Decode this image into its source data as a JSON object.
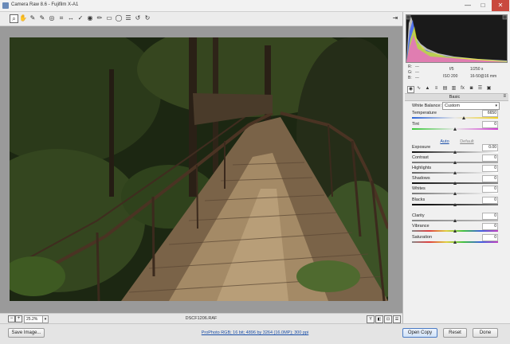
{
  "window": {
    "title": "Camera Raw 8.6  -  Fujifilm X-A1",
    "controls": {
      "minimize": "—",
      "maximize": "□",
      "close": "✕"
    }
  },
  "toolbar": {
    "tools": [
      "zoom-tool",
      "hand-tool",
      "white-balance-tool",
      "color-sampler-tool",
      "targeted-adjustment-tool",
      "crop-tool",
      "straighten-tool",
      "spot-removal-tool",
      "red-eye-tool",
      "adjustment-brush-tool",
      "graduated-filter-tool",
      "radial-filter-tool",
      "open-preferences",
      "rotate-ccw",
      "rotate-cw"
    ],
    "glyphs": [
      "⌕",
      "✋",
      "✎",
      "✎",
      "◎",
      "⌗",
      "↔",
      "✓",
      "◉",
      "✏",
      "▭",
      "◯",
      "☰",
      "↺",
      "↻"
    ],
    "fullscreen_glyph": "⇥"
  },
  "status": {
    "zoom_value": "25.2%",
    "zoom_out": "−",
    "zoom_in": "+",
    "dropdown": "▾",
    "filename": "DSCF1206.RAF",
    "right_icons": [
      "Y",
      "◧",
      "⊡",
      "☰"
    ]
  },
  "info": {
    "rgb": {
      "R": "R:",
      "G": "G:",
      "B": "B:",
      "r_val": "---",
      "g_val": "---",
      "b_val": "---"
    },
    "aperture": "f/5",
    "shutter": "1/250 s",
    "iso": "ISO 200",
    "lens": "16-50@16 mm"
  },
  "panel_tabs": [
    "◉",
    "∿",
    "▲",
    "≡",
    "▤",
    "▥",
    "fx",
    "◙",
    "☰",
    "▣"
  ],
  "basic": {
    "title": "Basic",
    "menu": "≡",
    "wb_label": "White Balance:",
    "wb_value": "Custom",
    "wb_arrow": "▾",
    "auto": "Auto",
    "default": "Default",
    "sliders": [
      {
        "name": "temperature",
        "label": "Temperature",
        "value": "6650",
        "pos": 0.6
      },
      {
        "name": "tint",
        "label": "Tint",
        "value": "0",
        "pos": 0.5
      },
      {
        "name": "exposure",
        "label": "Exposure",
        "value": "0.00",
        "pos": 0.5
      },
      {
        "name": "contrast",
        "label": "Contrast",
        "value": "0",
        "pos": 0.5
      },
      {
        "name": "highlights",
        "label": "Highlights",
        "value": "0",
        "pos": 0.5
      },
      {
        "name": "shadows",
        "label": "Shadows",
        "value": "0",
        "pos": 0.5
      },
      {
        "name": "whites",
        "label": "Whites",
        "value": "0",
        "pos": 0.5
      },
      {
        "name": "blacks",
        "label": "Blacks",
        "value": "0",
        "pos": 0.5
      },
      {
        "name": "clarity",
        "label": "Clarity",
        "value": "0",
        "pos": 0.5
      },
      {
        "name": "vibrance",
        "label": "Vibrance",
        "value": "0",
        "pos": 0.5
      },
      {
        "name": "saturation",
        "label": "Saturation",
        "value": "0",
        "pos": 0.5
      }
    ]
  },
  "bottom": {
    "save": "Save Image...",
    "workflow": "ProPhoto RGB; 16 bit; 4896 by 3264 (16.0MP); 300 ppi",
    "open": "Open Copy",
    "reset": "Reset",
    "done": "Done"
  },
  "colors": {
    "accent": "#1b4fa8",
    "close": "#c94a3f"
  }
}
